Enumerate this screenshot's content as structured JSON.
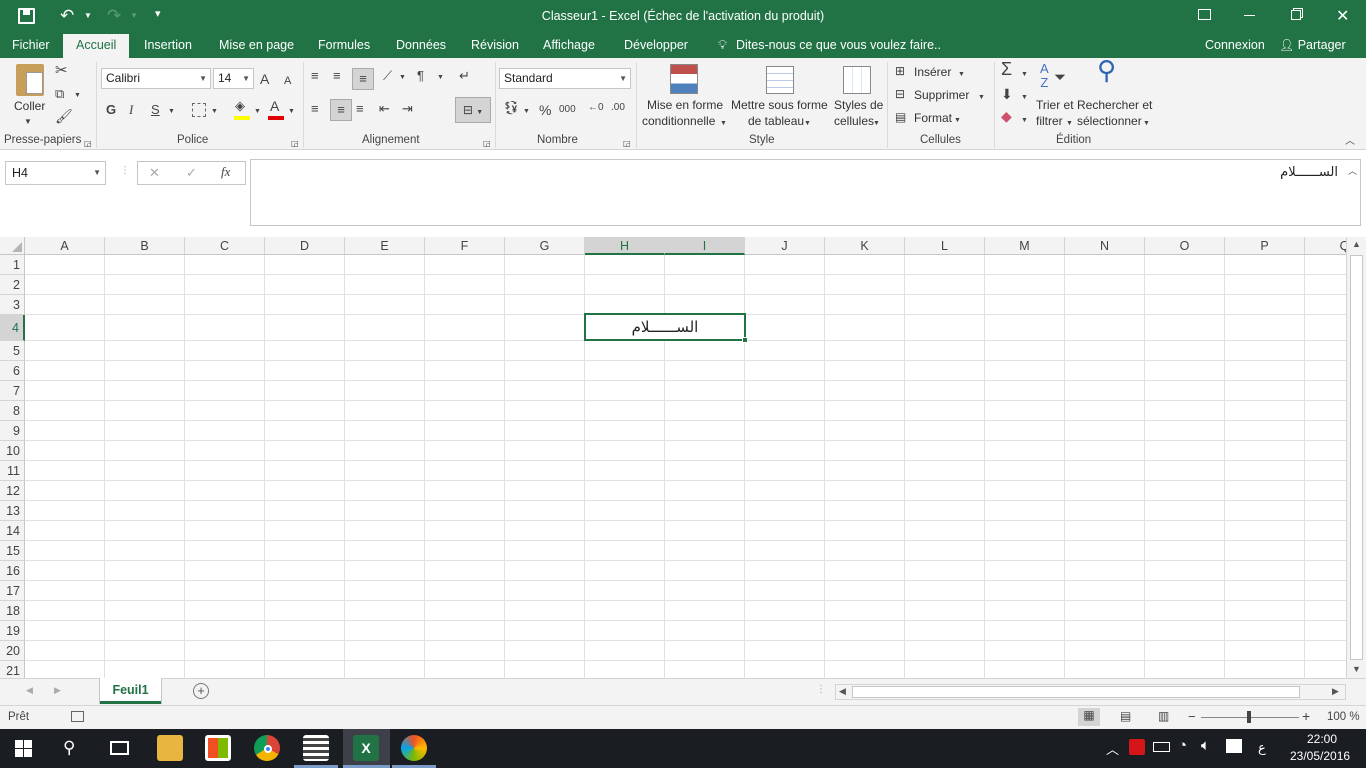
{
  "titlebar": {
    "title": "Classeur1 - Excel (Échec de l'activation du produit)"
  },
  "tabs": {
    "file": "Fichier",
    "home": "Accueil",
    "insert": "Insertion",
    "layout": "Mise en page",
    "formulas": "Formules",
    "data": "Données",
    "review": "Révision",
    "view": "Affichage",
    "developer": "Développer",
    "tellme": "Dites-nous ce que vous voulez faire..",
    "signin": "Connexion",
    "share": "Partager"
  },
  "ribbon": {
    "clipboard": {
      "paste": "Coller",
      "group": "Presse-papiers"
    },
    "font": {
      "name": "Calibri",
      "size": "14",
      "group": "Police",
      "bold": "G",
      "italic": "I",
      "underline": "S",
      "grow": "A",
      "shrink": "A"
    },
    "alignment": {
      "group": "Alignement"
    },
    "number": {
      "format": "Standard",
      "group": "Nombre",
      "percent": "%",
      "thousands": "000"
    },
    "style": {
      "cond_format_1": "Mise en forme",
      "cond_format_2": "conditionnelle",
      "table_1": "Mettre sous forme",
      "table_2": "de tableau",
      "cell_styles_1": "Styles de",
      "cell_styles_2": "cellules",
      "group": "Style"
    },
    "cells": {
      "insert": "Insérer",
      "delete": "Supprimer",
      "format": "Format",
      "group": "Cellules"
    },
    "editing": {
      "sort_1": "Trier et",
      "sort_2": "filtrer",
      "find_1": "Rechercher et",
      "find_2": "sélectionner",
      "group": "Édition"
    }
  },
  "formula_bar": {
    "name_box": "H4",
    "cancel": "✕",
    "enter": "✓",
    "fx": "fx",
    "content": "الســــــلام"
  },
  "grid": {
    "columns": [
      "A",
      "B",
      "C",
      "D",
      "E",
      "F",
      "G",
      "H",
      "I",
      "J",
      "K",
      "L",
      "M",
      "N",
      "O",
      "P",
      "Q"
    ],
    "rows": [
      "1",
      "2",
      "3",
      "4",
      "5",
      "6",
      "7",
      "8",
      "9",
      "10",
      "11",
      "12",
      "13",
      "14",
      "15",
      "16",
      "17",
      "18",
      "19",
      "20",
      "21"
    ],
    "selected_cell": "H4",
    "cells": {
      "H4": "الســــــلام"
    }
  },
  "sheets": {
    "active": "Feuil1",
    "add": "+"
  },
  "status": {
    "ready": "Prêt",
    "zoom": "100 %",
    "minus": "−",
    "plus": "+"
  },
  "taskbar": {
    "time": "22:00",
    "date": "23/05/2016",
    "lang": "ع"
  },
  "colors": {
    "excel_green": "#217346",
    "ribbon_bg": "#f3f3f3",
    "taskbar": "#1a1d22"
  }
}
